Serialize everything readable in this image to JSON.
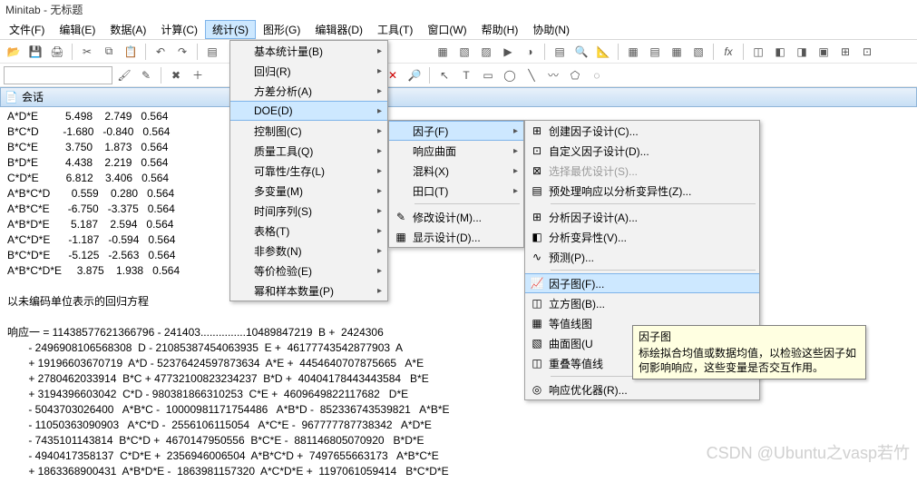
{
  "window": {
    "title": "Minitab - 无标题"
  },
  "menubar": {
    "items": [
      {
        "label": "文件(F)"
      },
      {
        "label": "编辑(E)"
      },
      {
        "label": "数据(A)"
      },
      {
        "label": "计算(C)"
      },
      {
        "label": "统计(S)",
        "open": true
      },
      {
        "label": "图形(G)"
      },
      {
        "label": "编辑器(D)"
      },
      {
        "label": "工具(T)"
      },
      {
        "label": "窗口(W)"
      },
      {
        "label": "帮助(H)"
      },
      {
        "label": "协助(N)"
      }
    ]
  },
  "session": {
    "title": "会话"
  },
  "dd_main": {
    "items": [
      {
        "label": "基本统计量(B)",
        "arrow": true
      },
      {
        "label": "回归(R)",
        "arrow": true
      },
      {
        "label": "方差分析(A)",
        "arrow": true
      },
      {
        "label": "DOE(D)",
        "arrow": true,
        "hl": true
      },
      {
        "label": "控制图(C)",
        "arrow": true
      },
      {
        "label": "质量工具(Q)",
        "arrow": true
      },
      {
        "label": "可靠性/生存(L)",
        "arrow": true
      },
      {
        "label": "多变量(M)",
        "arrow": true
      },
      {
        "label": "时间序列(S)",
        "arrow": true
      },
      {
        "label": "表格(T)",
        "arrow": true
      },
      {
        "label": "非参数(N)",
        "arrow": true
      },
      {
        "label": "等价检验(E)",
        "arrow": true
      },
      {
        "label": "幂和样本数量(P)",
        "arrow": true
      }
    ]
  },
  "dd_doe": {
    "items": [
      {
        "label": "因子(F)",
        "arrow": true,
        "hl": true
      },
      {
        "label": "响应曲面",
        "arrow": true
      },
      {
        "label": "混料(X)",
        "arrow": true
      },
      {
        "label": "田口(T)",
        "arrow": true
      },
      {
        "sep": true
      },
      {
        "label": "修改设计(M)..."
      },
      {
        "label": "显示设计(D)..."
      }
    ]
  },
  "dd_factor": {
    "items": [
      {
        "label": "创建因子设计(C)..."
      },
      {
        "label": "自定义因子设计(D)..."
      },
      {
        "label": "选择最优设计(S)...",
        "disabled": true
      },
      {
        "label": "预处理响应以分析变异性(Z)..."
      },
      {
        "sep": true
      },
      {
        "label": "分析因子设计(A)..."
      },
      {
        "label": "分析变异性(V)..."
      },
      {
        "label": "预测(P)..."
      },
      {
        "sep": true
      },
      {
        "label": "因子图(F)...",
        "hl": true
      },
      {
        "label": "立方图(B)..."
      },
      {
        "label": "等值线图"
      },
      {
        "label": "曲面图(U"
      },
      {
        "label": "重叠等值线"
      },
      {
        "sep": true
      },
      {
        "label": "响应优化器(R)..."
      }
    ]
  },
  "tooltip": {
    "title": "因子图",
    "body": "标绘拟合均值或数据均值，以检验这些因子如何影响响应，这些变量是否交互作用。"
  },
  "watermark": "CSDN @Ubuntu之vasp若竹",
  "data_block": "A*D*E         5.498    2.749   0.564\nB*C*D        -1.680   -0.840   0.564\nB*C*E         3.750    1.873   0.564\nB*D*E         4.438    2.219   0.564\nC*D*E         6.812    3.406   0.564\nA*B*C*D       0.559    0.280   0.564\nA*B*C*E      -6.750   -3.375   0.564\nA*B*D*E       5.187    2.594   0.564\nA*C*D*E      -1.187   -0.594   0.564\nB*C*D*E      -5.125   -2.563   0.564\nA*B*C*D*E     3.875    1.938   0.564\n\n以未编码单位表示的回归方程\n\n响应一 = 11438577621366796 - 241403...............10489847219  B +  2424306\n       - 2496908106568308  D - 21085387454063935  E +  46177743542877903  A\n       + 19196603670719  A*D - 52376424597873634  A*E +  4454640707875665   A*E\n       + 2780462033914  B*C + 47732100823234237  B*D +  40404178443443584   B*E\n       + 3194396603042  C*D - 980381866310253  C*E +  4609649822117682   D*E\n       - 5043703026400   A*B*C -  10000981171754486   A*B*D -  852336743539821   A*B*E\n       - 11050363090903   A*C*D -  2556106115054   A*C*E -  967777787738342   A*D*E\n       - 7435101143814  B*C*D +  4670147950556  B*C*E -  881146805070920   B*D*E\n       - 4940417358137  C*D*E +  2356946006504  A*B*C*D +  7497655663173   A*B*C*E\n       + 1863368900431  A*B*D*E -  1863981157320  A*C*D*E +  1197061059414   B*C*D*E"
}
